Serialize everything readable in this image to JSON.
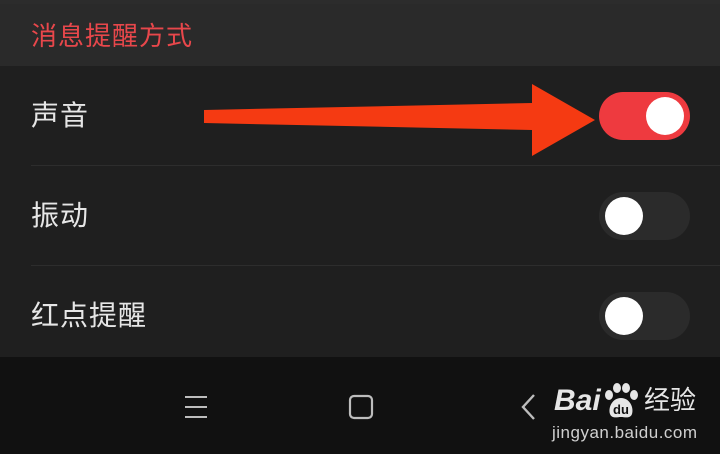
{
  "section": {
    "title": "消息提醒方式"
  },
  "settings": [
    {
      "label": "声音",
      "enabled": true
    },
    {
      "label": "振动",
      "enabled": false
    },
    {
      "label": "红点提醒",
      "enabled": false
    }
  ],
  "colors": {
    "accent": "#ee3a3f",
    "title": "#e8474b",
    "arrow": "#f53a12",
    "toggle_off": "#2b2b2b",
    "background": "#1e1e1e"
  },
  "navbar": {
    "icons": [
      "menu-icon",
      "home-square-icon",
      "back-chevron-icon"
    ]
  },
  "watermark": {
    "brand_latin": "Bai",
    "brand_suffix": "经验",
    "url": "jingyan.baidu.com"
  }
}
